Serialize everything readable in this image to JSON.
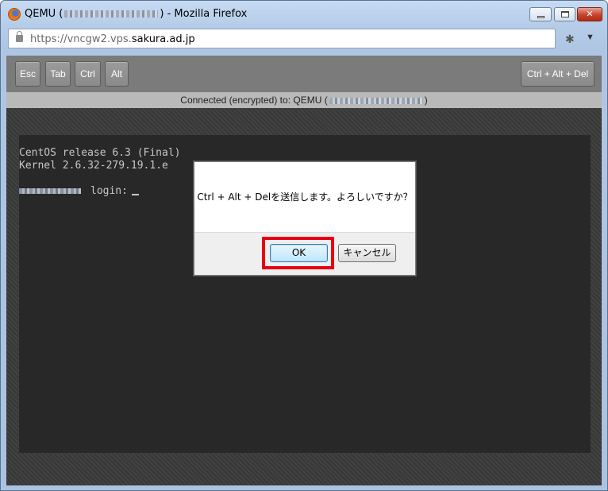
{
  "window": {
    "title_prefix": "QEMU (",
    "title_suffix": ") - Mozilla Firefox",
    "minimize_glyph": "",
    "close_glyph": "✕"
  },
  "urlbar": {
    "url_scheme": "https://vncgw2.vps.",
    "url_domain": "sakura.ad.jp"
  },
  "toolbar": {
    "keys": [
      "Esc",
      "Tab",
      "Ctrl",
      "Alt"
    ],
    "ctrl_alt_del": "Ctrl + Alt + Del"
  },
  "status": {
    "prefix": "Connected (encrypted) to: QEMU (",
    "suffix": ")"
  },
  "terminal": {
    "line1": "CentOS release 6.3 (Final)",
    "line2": "Kernel 2.6.32-279.19.1.e",
    "login_prompt": "login:"
  },
  "dialog": {
    "message": "Ctrl + Alt + Delを送信します。よろしいですか？",
    "ok_label": "OK",
    "cancel_label": "キャンセル"
  },
  "colors": {
    "highlight": "#e60012",
    "terminal_bg": "#282828"
  }
}
